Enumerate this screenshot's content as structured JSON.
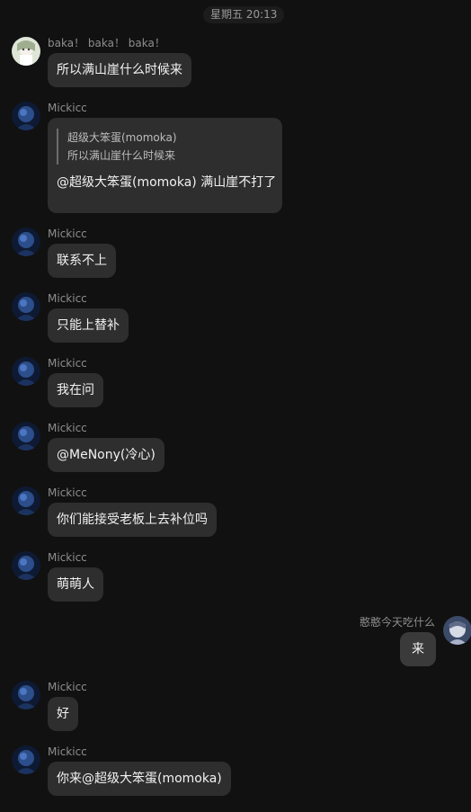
{
  "timestamp": "星期五 20:13",
  "messages": [
    {
      "sender": "baka！ baka！ baka！",
      "text": "所以满山崖什么时候来"
    },
    {
      "sender": "Mickicc",
      "quote_author": "超级大笨蛋(momoka)",
      "quote_text": "所以满山崖什么时候来",
      "text": "@超级大笨蛋(momoka) 满山崖不打了"
    },
    {
      "sender": "Mickicc",
      "text": "联系不上"
    },
    {
      "sender": "Mickicc",
      "text": "只能上替补"
    },
    {
      "sender": "Mickicc",
      "text": "我在问"
    },
    {
      "sender": "Mickicc",
      "text": "@MeNony(冷心)"
    },
    {
      "sender": "Mickicc",
      "text": "你们能接受老板上去补位吗"
    },
    {
      "sender": "Mickicc",
      "text": "萌萌人"
    },
    {
      "sender": "憨憨今天吃什么",
      "text": "来"
    },
    {
      "sender": "Mickicc",
      "text": "好"
    },
    {
      "sender": "Mickicc",
      "text": "你来@超级大笨蛋(momoka)"
    }
  ]
}
